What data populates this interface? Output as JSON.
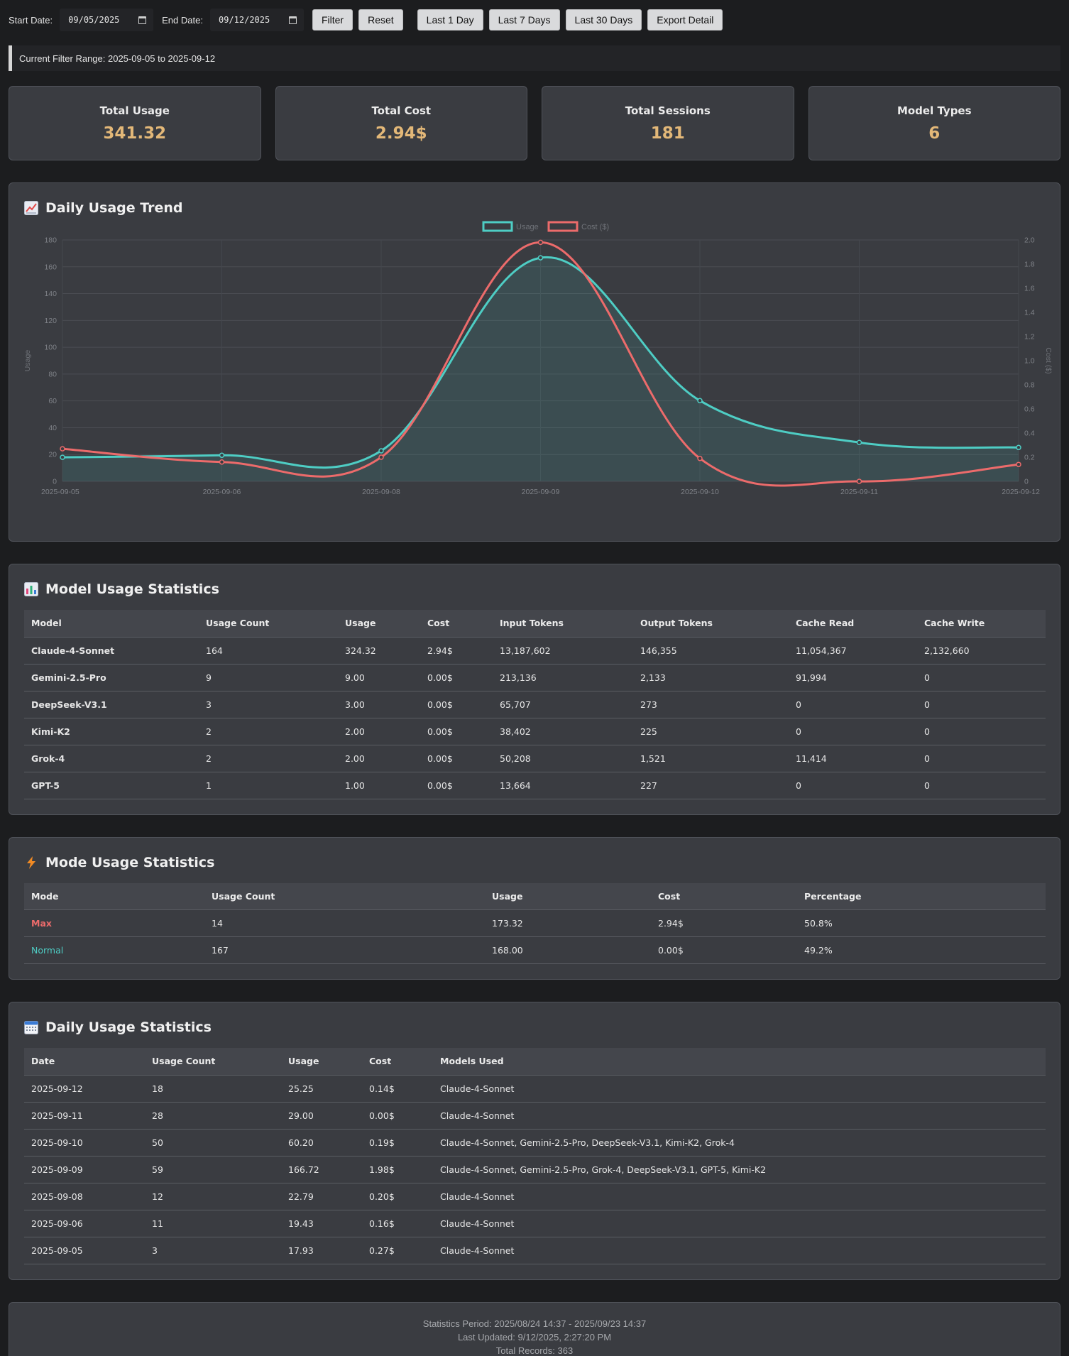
{
  "filter": {
    "start_label": "Start Date:",
    "start_value": "09/05/2025",
    "end_label": "End Date:",
    "end_value": "09/12/2025",
    "buttons": [
      "Filter",
      "Reset"
    ],
    "quick_buttons": [
      "Last 1 Day",
      "Last 7 Days",
      "Last 30 Days",
      "Export Detail"
    ]
  },
  "range_text": "Current Filter Range: 2025-09-05 to 2025-09-12",
  "stats": [
    {
      "title": "Total Usage",
      "value": "341.32"
    },
    {
      "title": "Total Cost",
      "value": "2.94$"
    },
    {
      "title": "Total Sessions",
      "value": "181"
    },
    {
      "title": "Model Types",
      "value": "6"
    }
  ],
  "trend": {
    "title": "Daily Usage Trend",
    "icon": "chart-increasing-icon"
  },
  "chart_data": {
    "type": "line",
    "x": [
      "2025-09-05",
      "2025-09-06",
      "2025-09-08",
      "2025-09-09",
      "2025-09-10",
      "2025-09-11",
      "2025-09-12"
    ],
    "series": [
      {
        "name": "Usage",
        "axis": "left",
        "color": "#4ecdc4",
        "values": [
          17.93,
          19.43,
          22.79,
          166.72,
          60.2,
          29.0,
          25.25
        ]
      },
      {
        "name": "Cost ($)",
        "axis": "right",
        "color": "#ec6b6b",
        "values": [
          0.27,
          0.16,
          0.2,
          1.98,
          0.19,
          0.0,
          0.14
        ]
      }
    ],
    "ylabel": "Usage",
    "y2label": "Cost ($)",
    "ylim": [
      0,
      180
    ],
    "yticks": [
      0,
      20,
      40,
      60,
      80,
      100,
      120,
      140,
      160,
      180
    ],
    "y2lim": [
      0,
      2.0
    ],
    "y2ticks": [
      "0",
      "0.2",
      "0.4",
      "0.6",
      "0.8",
      "1.0",
      "1.2",
      "1.4",
      "1.6",
      "1.8",
      "2.0"
    ],
    "legend": "top-center",
    "grid": true
  },
  "model_table": {
    "title": "Model Usage Statistics",
    "icon": "bar-chart-icon",
    "headers": [
      "Model",
      "Usage Count",
      "Usage",
      "Cost",
      "Input Tokens",
      "Output Tokens",
      "Cache Read",
      "Cache Write"
    ],
    "rows": [
      [
        "Claude-4-Sonnet",
        "164",
        "324.32",
        "2.94$",
        "13,187,602",
        "146,355",
        "11,054,367",
        "2,132,660"
      ],
      [
        "Gemini-2.5-Pro",
        "9",
        "9.00",
        "0.00$",
        "213,136",
        "2,133",
        "91,994",
        "0"
      ],
      [
        "DeepSeek-V3.1",
        "3",
        "3.00",
        "0.00$",
        "65,707",
        "273",
        "0",
        "0"
      ],
      [
        "Kimi-K2",
        "2",
        "2.00",
        "0.00$",
        "38,402",
        "225",
        "0",
        "0"
      ],
      [
        "Grok-4",
        "2",
        "2.00",
        "0.00$",
        "50,208",
        "1,521",
        "11,414",
        "0"
      ],
      [
        "GPT-5",
        "1",
        "1.00",
        "0.00$",
        "13,664",
        "227",
        "0",
        "0"
      ]
    ]
  },
  "mode_table": {
    "title": "Mode Usage Statistics",
    "icon": "lightning-icon",
    "headers": [
      "Mode",
      "Usage Count",
      "Usage",
      "Cost",
      "Percentage"
    ],
    "rows": [
      [
        "Max",
        "14",
        "173.32",
        "2.94$",
        "50.8%"
      ],
      [
        "Normal",
        "167",
        "168.00",
        "0.00$",
        "49.2%"
      ]
    ]
  },
  "daily_table": {
    "title": "Daily Usage Statistics",
    "icon": "calendar-icon",
    "headers": [
      "Date",
      "Usage Count",
      "Usage",
      "Cost",
      "Models Used"
    ],
    "rows": [
      [
        "2025-09-12",
        "18",
        "25.25",
        "0.14$",
        "Claude-4-Sonnet"
      ],
      [
        "2025-09-11",
        "28",
        "29.00",
        "0.00$",
        "Claude-4-Sonnet"
      ],
      [
        "2025-09-10",
        "50",
        "60.20",
        "0.19$",
        "Claude-4-Sonnet, Gemini-2.5-Pro, DeepSeek-V3.1, Kimi-K2, Grok-4"
      ],
      [
        "2025-09-09",
        "59",
        "166.72",
        "1.98$",
        "Claude-4-Sonnet, Gemini-2.5-Pro, Grok-4, DeepSeek-V3.1, GPT-5, Kimi-K2"
      ],
      [
        "2025-09-08",
        "12",
        "22.79",
        "0.20$",
        "Claude-4-Sonnet"
      ],
      [
        "2025-09-06",
        "11",
        "19.43",
        "0.16$",
        "Claude-4-Sonnet"
      ],
      [
        "2025-09-05",
        "3",
        "17.93",
        "0.27$",
        "Claude-4-Sonnet"
      ]
    ]
  },
  "footer": {
    "period": "Statistics Period: 2025/08/24 14:37 - 2025/09/23 14:37",
    "updated": "Last Updated: 9/12/2025, 2:27:20 PM",
    "records": "Total Records: 363"
  }
}
